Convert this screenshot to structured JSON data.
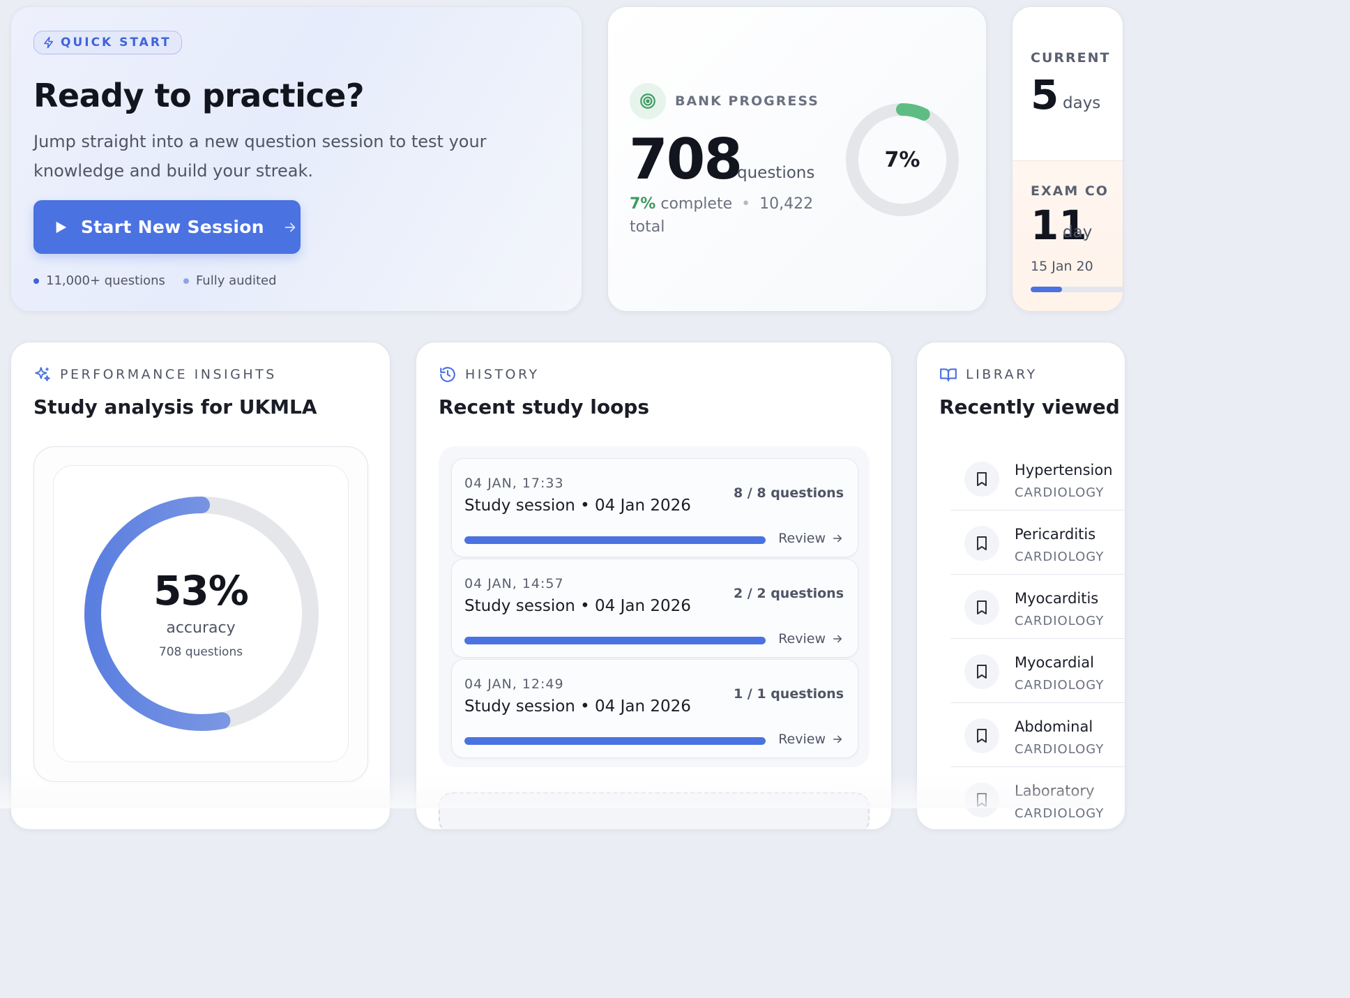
{
  "quick_start": {
    "badge": "QUICK START",
    "title": "Ready to practice?",
    "description": "Jump straight into a new question session to test your knowledge and build your streak.",
    "button_label": "Start New Session",
    "meta": [
      "11,000+ questions",
      "Fully audited"
    ],
    "meta_colors": [
      "#3f63d9",
      "#8ea4e8"
    ]
  },
  "bank_progress": {
    "label": "BANK PROGRESS",
    "count": "708",
    "unit": "questions",
    "percent_text": "7%",
    "complete_word": "complete",
    "separator": "•",
    "total": "10,422",
    "total_word": "total",
    "progress": 0.07,
    "ring_label": "7%",
    "accent": "#5dbd83"
  },
  "streak": {
    "current_label": "CURRENT",
    "current_value": "5",
    "current_unit": "days",
    "exam_label": "EXAM CO",
    "exam_value": "11",
    "exam_unit": "day",
    "exam_date": "15 Jan 20",
    "exam_progress": 0.32
  },
  "performance": {
    "header": "PERFORMANCE INSIGHTS",
    "title": "Study analysis for UKMLA",
    "accuracy_pct": "53%",
    "accuracy_label": "accuracy",
    "questions_label": "708 questions",
    "accuracy_value": 0.53
  },
  "history": {
    "header": "HISTORY",
    "title": "Recent study loops",
    "review_label": "Review",
    "items": [
      {
        "time": "04 JAN, 17:33",
        "title": "Study session • 04 Jan 2026",
        "count": "8 / 8 questions",
        "progress": 1.0
      },
      {
        "time": "04 JAN, 14:57",
        "title": "Study session • 04 Jan 2026",
        "count": "2 / 2 questions",
        "progress": 1.0
      },
      {
        "time": "04 JAN, 12:49",
        "title": "Study session • 04 Jan 2026",
        "count": "1 / 1 questions",
        "progress": 1.0
      }
    ]
  },
  "library": {
    "header": "LIBRARY",
    "title": "Recently viewed",
    "items": [
      {
        "name": "Hypertension",
        "category": "CARDIOLOGY"
      },
      {
        "name": "Pericarditis",
        "category": "CARDIOLOGY"
      },
      {
        "name": "Myocarditis",
        "category": "CARDIOLOGY"
      },
      {
        "name": "Myocardial",
        "category": "CARDIOLOGY"
      },
      {
        "name": "Abdominal",
        "category": "CARDIOLOGY"
      },
      {
        "name": "Laboratory",
        "category": "CARDIOLOGY"
      }
    ]
  },
  "icons": {
    "quick_start": "bolt-icon",
    "start": "play-icon",
    "arrow": "arrow-right-icon",
    "bank": "target-icon",
    "performance": "sparkles-icon",
    "history": "history-icon",
    "library": "book-open-icon",
    "library_item": "bookmark-icon"
  },
  "colors": {
    "primary": "#4a72e0",
    "success": "#3f9a62",
    "ring_track": "#e4e6ea"
  }
}
